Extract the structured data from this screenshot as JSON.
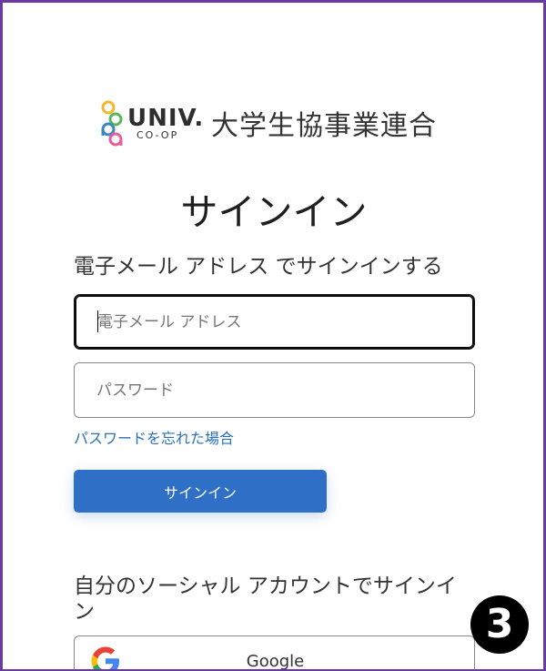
{
  "brand": {
    "word": "UNIV.",
    "sub": "CO-OP",
    "name_jp": "大学生協事業連合",
    "colors": {
      "yellow": "#f2b62f",
      "green": "#5bb65a",
      "blue": "#3e87c7",
      "pink": "#e5609a"
    }
  },
  "page": {
    "title": "サインイン"
  },
  "login": {
    "subtitle": "電子メール アドレス でサインインする",
    "email_placeholder": "電子メール アドレス",
    "password_placeholder": "パスワード",
    "forgot_link": "パスワードを忘れた場合",
    "signin_button": "サインイン"
  },
  "social": {
    "title": "自分のソーシャル アカウントでサインイン",
    "google_label": "Google"
  },
  "annotation": {
    "step": "3"
  },
  "colors": {
    "accent": "#2f6fc5",
    "link": "#2a6fb8",
    "frame": "#6a3aa3"
  }
}
